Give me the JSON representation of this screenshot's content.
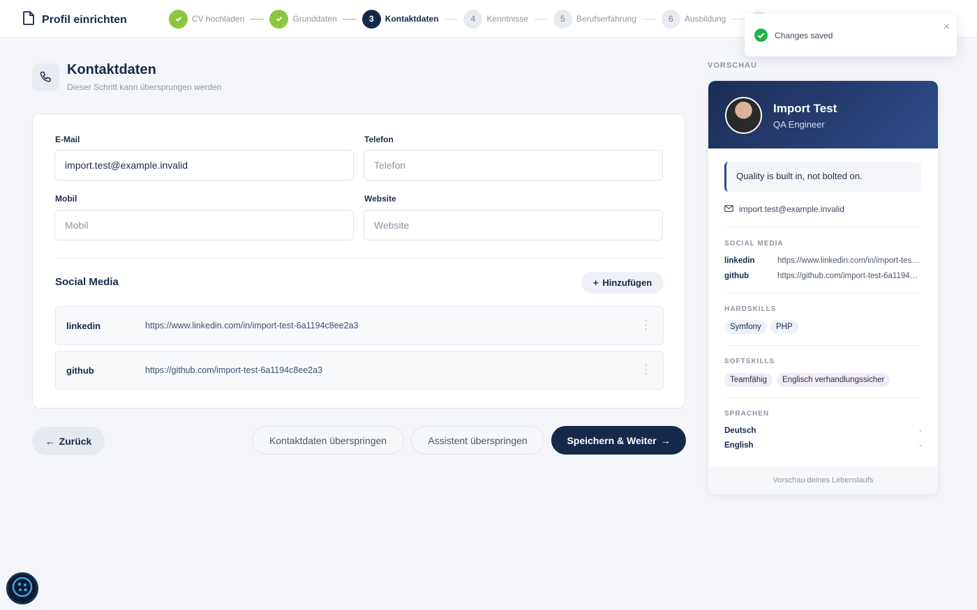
{
  "app": {
    "title": "Profil einrichten"
  },
  "steps": [
    {
      "label": "CV hochladen",
      "state": "done",
      "number": ""
    },
    {
      "label": "Grunddaten",
      "state": "done",
      "number": ""
    },
    {
      "label": "Kontaktdaten",
      "state": "active",
      "number": "3"
    },
    {
      "label": "Kenntnisse",
      "state": "todo",
      "number": "4"
    },
    {
      "label": "Berufserfahrung",
      "state": "todo",
      "number": "5"
    },
    {
      "label": "Ausbildung",
      "state": "todo",
      "number": "6"
    }
  ],
  "toast": {
    "message": "Changes saved",
    "close": "×"
  },
  "header": {
    "title": "Kontaktdaten",
    "subtitle": "Dieser Schritt kann übersprungen werden"
  },
  "form": {
    "email": {
      "label": "E-Mail",
      "value": "import.test@example.invalid",
      "placeholder": "E-Mail"
    },
    "phone": {
      "label": "Telefon",
      "value": "",
      "placeholder": "Telefon"
    },
    "mobile": {
      "label": "Mobil",
      "value": "",
      "placeholder": "Mobil"
    },
    "website": {
      "label": "Website",
      "value": "",
      "placeholder": "Website"
    }
  },
  "social": {
    "title": "Social Media",
    "add_label": "Hinzufügen",
    "items": [
      {
        "name": "linkedin",
        "url": "https://www.linkedin.com/in/import-test-6a1194c8ee2a3"
      },
      {
        "name": "github",
        "url": "https://github.com/import-test-6a1194c8ee2a3"
      }
    ]
  },
  "actions": {
    "back": "Zurück",
    "skip_contact": "Kontaktdaten überspringen",
    "skip_wizard": "Assistent überspringen",
    "save_next": "Speichern & Weiter"
  },
  "preview": {
    "section_title": "VORSCHAU",
    "name": "Import Test",
    "role": "QA Engineer",
    "quote": "Quality is built in, not bolted on.",
    "email": "import.test@example.invalid",
    "social_title": "SOCIAL MEDIA",
    "social": [
      {
        "name": "linkedin",
        "url": "https://www.linkedin.com/in/import-test-6a1194c8ee2a3"
      },
      {
        "name": "github",
        "url": "https://github.com/import-test-6a1194c8ee2a3"
      }
    ],
    "hardskills_title": "HARDSKILLS",
    "hardskills": [
      "Symfony",
      "PHP"
    ],
    "softskills_title": "SOFTSKILLS",
    "softskills": [
      "Teamfähig",
      "Englisch verhandlungssicher"
    ],
    "languages_title": "SPRACHEN",
    "languages": [
      {
        "name": "Deutsch",
        "level": "-"
      },
      {
        "name": "English",
        "level": "-"
      }
    ],
    "footer": "Vorschau deines Lebenslaufs"
  },
  "colors": {
    "primary": "#15294b",
    "success": "#8cc63f",
    "accent": "#2f4d8a"
  }
}
